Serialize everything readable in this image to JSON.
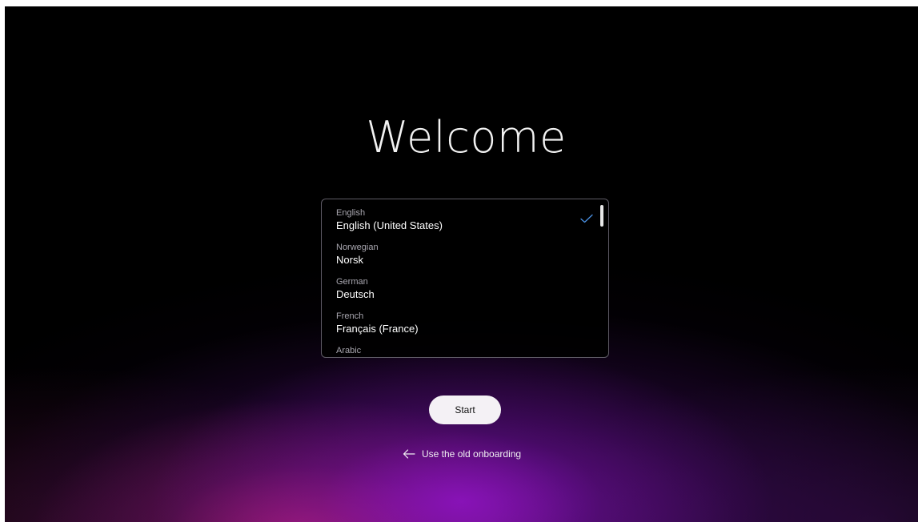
{
  "title": "Welcome",
  "languages": [
    {
      "name": "English",
      "native": "English (United States)",
      "selected": true
    },
    {
      "name": "Norwegian",
      "native": "Norsk",
      "selected": false
    },
    {
      "name": "German",
      "native": "Deutsch",
      "selected": false
    },
    {
      "name": "French",
      "native": "Français (France)",
      "selected": false
    },
    {
      "name": "Arabic",
      "native": "",
      "selected": false
    }
  ],
  "selected_icon": "checkmark-icon",
  "start_label": "Start",
  "old_onboarding": {
    "icon": "arrow-left-icon",
    "label": "Use the old onboarding"
  },
  "colors": {
    "accent_check": "#4a90e2",
    "background": "#000000",
    "glow_purple": "#8a14c8",
    "glow_magenta": "#c2237a"
  }
}
